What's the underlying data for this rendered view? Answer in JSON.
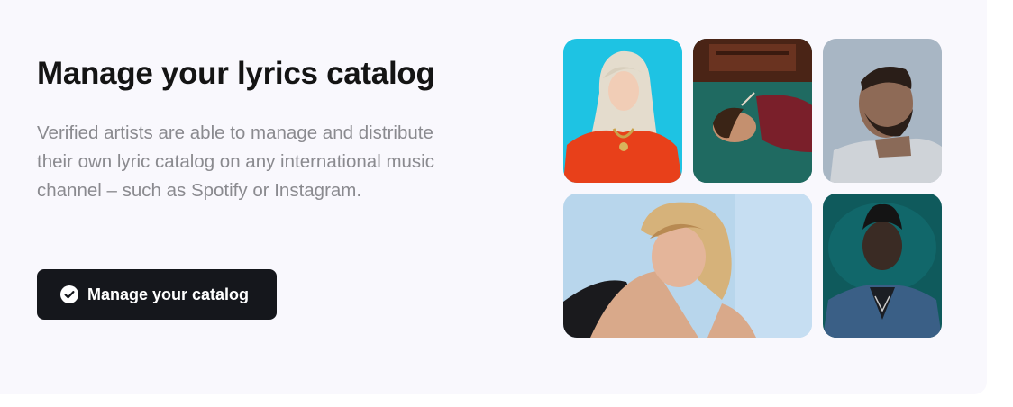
{
  "section": {
    "title": "Manage your lyrics catalog",
    "description": "Verified artists are able to manage and distribute their own lyric catalog on any international music channel – such as Spotify or Instagram.",
    "cta_label": "Manage your catalog",
    "cta_icon": "check-circle-icon"
  },
  "gallery": {
    "photos": [
      {
        "name": "artist-photo-blonde-red-hoodie",
        "bg": "#1ec3e3"
      },
      {
        "name": "artist-photo-lying-on-green-carpet",
        "bg": "#1d5f57"
      },
      {
        "name": "artist-photo-bearded-man-grey-hoodie",
        "bg": "#a8b6c4"
      },
      {
        "name": "artist-photo-blonde-woman-leaning",
        "bg": "#b8d6ec"
      },
      {
        "name": "artist-photo-man-denim-jacket-teal",
        "bg": "#0f5a5c"
      }
    ]
  },
  "colors": {
    "background": "#f9f8fd",
    "button": "#15171c",
    "heading": "#141414",
    "body_text": "#8a8a8f"
  }
}
